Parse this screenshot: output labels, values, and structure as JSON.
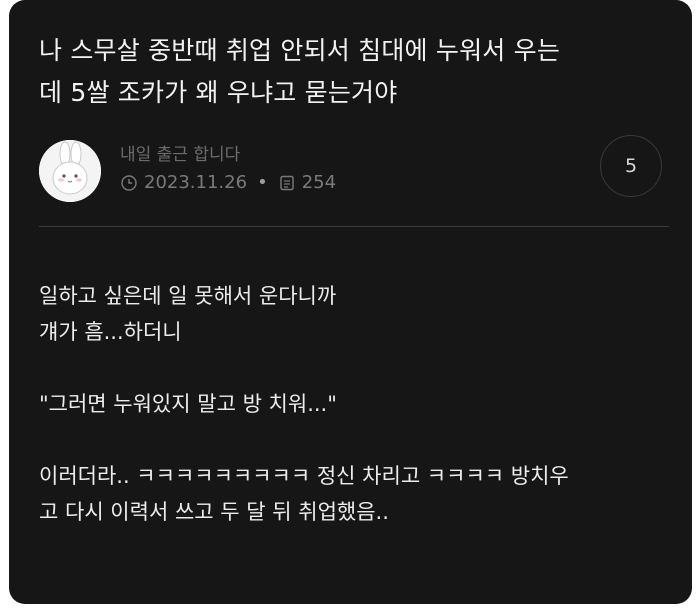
{
  "post": {
    "title_line1": "나 스무살 중반때 취업 안되서 침대에 누워서 우는",
    "title_line2": "데 5쌀 조카가 왜 우냐고 묻는거야",
    "author": "내일 출근 합니다",
    "date": "2023.11.26",
    "views": "254",
    "comment_count": "5",
    "body": [
      "일하고 싶은데 일 못해서 운다니까",
      "걔가 흠...하더니",
      "",
      "\"그러면 누워있지 말고 방 치워...\"",
      "",
      "이러더라.. ㅋㅋㅋㅋㅋㅋㅋㅋㅋ 정신 차리고 ㅋㅋㅋㅋ 방치우",
      "고 다시 이력서 쓰고 두 달 뒤 취업했음.."
    ]
  },
  "icons": {
    "date": "clock-icon",
    "views": "document-icon",
    "avatar": "rabbit-avatar"
  },
  "colors": {
    "card_background": "#161616",
    "text_primary": "#ececec",
    "text_muted": "#7a7a7a",
    "divider": "#3a3a3a"
  }
}
